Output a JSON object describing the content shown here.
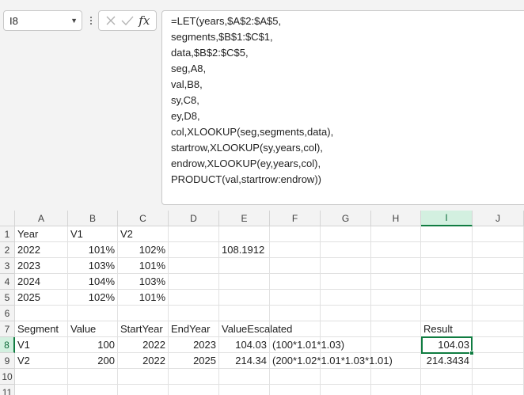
{
  "name_box": {
    "value": "I8"
  },
  "formula_bar": {
    "fx_label": "fx",
    "lines": [
      "=LET(years,$A$2:$A$5,",
      "segments,$B$1:$C$1,",
      "data,$B$2:$C$5,",
      "seg,A8,",
      "val,B8,",
      "sy,C8,",
      "ey,D8,",
      "col,XLOOKUP(seg,segments,data),",
      "startrow,XLOOKUP(sy,years,col),",
      "endrow,XLOOKUP(ey,years,col),",
      "PRODUCT(val,startrow:endrow))"
    ]
  },
  "grid": {
    "columns": [
      "A",
      "B",
      "C",
      "D",
      "E",
      "F",
      "G",
      "H",
      "I",
      "J"
    ],
    "rows": [
      "1",
      "2",
      "3",
      "4",
      "5",
      "6",
      "7",
      "8",
      "9",
      "10",
      "11"
    ],
    "selected_cell": "I8",
    "cells": {
      "A1": "Year",
      "B1": "V1",
      "C1": "V2",
      "A2": "2022",
      "B2": "101%",
      "C2": "102%",
      "E2": "108.1912",
      "A3": "2023",
      "B3": "103%",
      "C3": "101%",
      "A4": "2024",
      "B4": "104%",
      "C4": "103%",
      "A5": "2025",
      "B5": "102%",
      "C5": "101%",
      "A7": "Segment",
      "B7": "Value",
      "C7": "StartYear",
      "D7": "EndYear",
      "E7": "ValueEscalated",
      "I7": "Result",
      "A8": "V1",
      "B8": "100",
      "C8": "2022",
      "D8": "2023",
      "E8": "104.03",
      "F8": "(100*1.01*1.03)",
      "I8": "104.03",
      "A9": "V2",
      "B9": "200",
      "C9": "2022",
      "D9": "2025",
      "E9": "214.34",
      "F9": "(200*1.02*1.01*1.03*1.01)",
      "I9": "214.3434"
    }
  },
  "colors": {
    "accent": "#107c41",
    "header_bg": "#f3f3f3",
    "gridline": "#e1e1e1"
  }
}
